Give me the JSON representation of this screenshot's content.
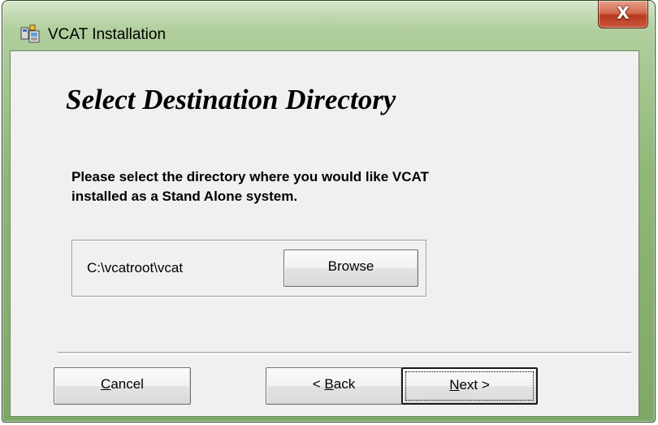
{
  "window": {
    "title": "VCAT Installation",
    "close_glyph": "X",
    "app_icon": "installer-icon",
    "colors": {
      "frame": "#8fb879",
      "close": "#c94a2a",
      "client": "#f0f0f0"
    }
  },
  "page": {
    "heading": "Select Destination Directory",
    "instructions_line1": "Please select the directory where you would like VCAT",
    "instructions_line2": "installed as a Stand Alone system."
  },
  "destination": {
    "path": "C:\\vcatroot\\vcat",
    "browse_label": "Browse"
  },
  "buttons": {
    "cancel": {
      "accel": "C",
      "rest": "ancel"
    },
    "back": {
      "prefix": "< ",
      "accel": "B",
      "rest": "ack"
    },
    "next": {
      "accel": "N",
      "rest": "ext",
      "suffix": " >"
    }
  }
}
